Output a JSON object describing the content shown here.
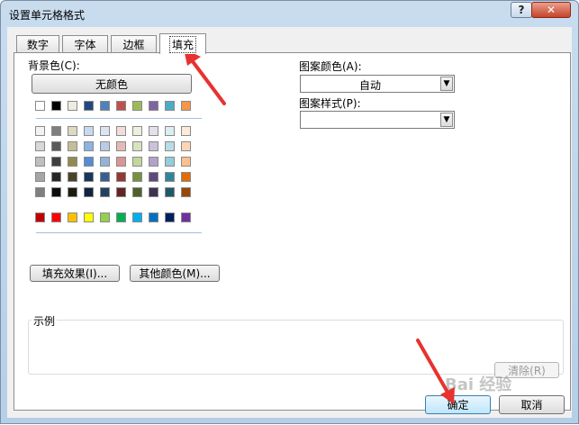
{
  "window": {
    "title": "设置单元格格式",
    "help": "?",
    "close": "✕"
  },
  "tabs": [
    {
      "label": "数字",
      "active": false
    },
    {
      "label": "字体",
      "active": false
    },
    {
      "label": "边框",
      "active": false
    },
    {
      "label": "填充",
      "active": true
    }
  ],
  "fill": {
    "bg_color_label": "背景色(C):",
    "no_color_button": "无颜色",
    "theme_top_row": [
      "#ffffff",
      "#000000",
      "#eeece1",
      "#1f497d",
      "#4f81bd",
      "#c0504d",
      "#9bbb59",
      "#8064a2",
      "#4bacc6",
      "#f79646"
    ],
    "theme_shades": [
      [
        "#f2f2f2",
        "#7f7f7f",
        "#ddd9c3",
        "#c6d9f0",
        "#dbe5f1",
        "#f2dcdb",
        "#ebf1dd",
        "#e5e0ec",
        "#dbeef3",
        "#fdeada"
      ],
      [
        "#d8d8d8",
        "#595959",
        "#c4bd97",
        "#8db3e2",
        "#b8cce4",
        "#e5b9b7",
        "#d7e3bc",
        "#ccc1d9",
        "#b7dde8",
        "#fbd5b5"
      ],
      [
        "#bfbfbf",
        "#3f3f3f",
        "#938953",
        "#548dd4",
        "#95b3d7",
        "#d99694",
        "#c3d69b",
        "#b2a2c7",
        "#92cddc",
        "#fac08f"
      ],
      [
        "#a5a5a5",
        "#262626",
        "#494429",
        "#17365d",
        "#366092",
        "#953734",
        "#76923c",
        "#5f497a",
        "#31859b",
        "#e36c09"
      ],
      [
        "#7f7f7f",
        "#0c0c0c",
        "#1d1b10",
        "#0f243e",
        "#244061",
        "#632423",
        "#4f6128",
        "#3f3151",
        "#205867",
        "#974806"
      ]
    ],
    "standard_colors": [
      "#c00000",
      "#ff0000",
      "#ffc000",
      "#ffff00",
      "#92d050",
      "#00b050",
      "#00b0f0",
      "#0070c0",
      "#002060",
      "#7030a0"
    ],
    "fill_effects_button": "填充效果(I)...",
    "more_colors_button": "其他颜色(M)...",
    "pattern_color_label": "图案颜色(A):",
    "pattern_color_value": "自动",
    "pattern_style_label": "图案样式(P):",
    "pattern_style_value": "",
    "sample_label": "示例",
    "clear_button": "清除(R)"
  },
  "footer": {
    "ok_button": "确定",
    "cancel_button": "取消"
  },
  "watermark": "Bai 经验"
}
